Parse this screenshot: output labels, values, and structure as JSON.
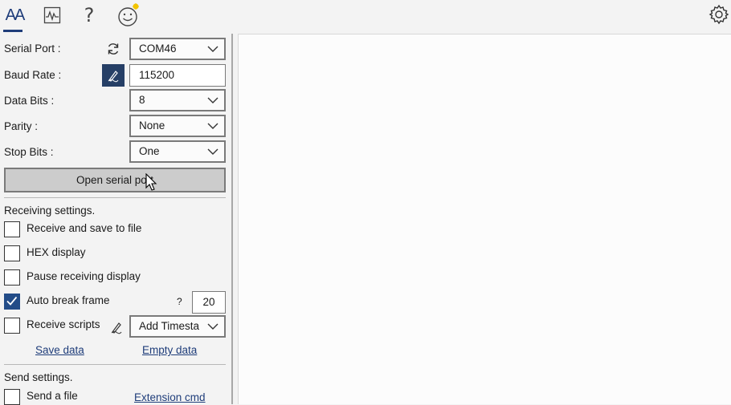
{
  "toolbar": {
    "tabs": [
      {
        "name": "font-size",
        "glyph": "AA"
      },
      {
        "name": "chart"
      },
      {
        "name": "help",
        "glyph": "?"
      },
      {
        "name": "emoji"
      }
    ],
    "active_tab_index": 0,
    "accent_color": "#1f3d7a"
  },
  "serial": {
    "port_label": "Serial Port :",
    "port_value": "COM46",
    "baud_label": "Baud Rate :",
    "baud_value": "115200",
    "databits_label": "Data Bits :",
    "databits_value": "8",
    "parity_label": "Parity :",
    "parity_value": "None",
    "stopbits_label": "Stop Bits :",
    "stopbits_value": "One",
    "open_button": "Open serial port"
  },
  "receive": {
    "title": "Receiving settings.",
    "options": [
      {
        "label": "Receive and save to file",
        "checked": false
      },
      {
        "label": "HEX display",
        "checked": false
      },
      {
        "label": "Pause receiving display",
        "checked": false
      },
      {
        "label": "Auto break frame",
        "checked": true
      },
      {
        "label": "Receive scripts",
        "checked": false
      }
    ],
    "frame_help": "?",
    "frame_value": "20",
    "script_value": "Add Timesta",
    "save_link": "Save data",
    "empty_link": "Empty data"
  },
  "send": {
    "title": "Send settings.",
    "send_file_label": "Send a file",
    "send_file_checked": false,
    "extension_link": "Extension cmd"
  }
}
